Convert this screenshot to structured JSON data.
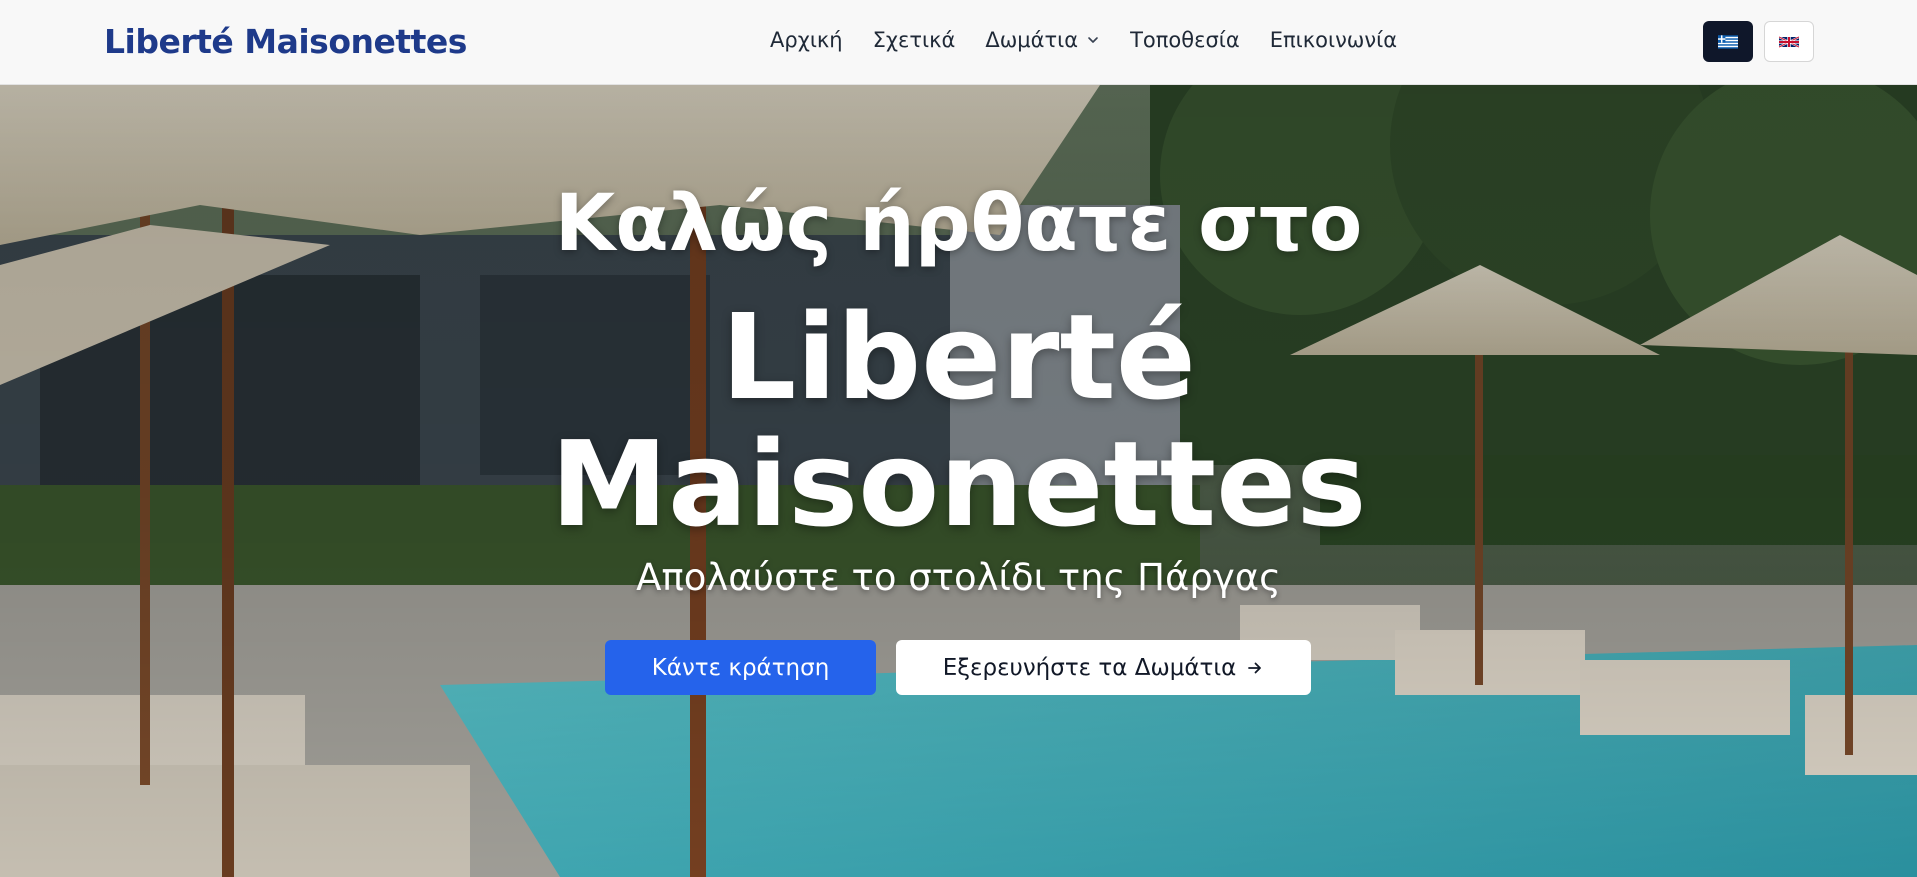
{
  "brand": {
    "name": "Liberté Maisonettes",
    "color": "#1e3a8a"
  },
  "nav": {
    "items": [
      {
        "label": "Αρχική"
      },
      {
        "label": "Σχετικά"
      },
      {
        "label": "Δωμάτια",
        "has_dropdown": true
      },
      {
        "label": "Τοποθεσία"
      },
      {
        "label": "Επικοινωνία"
      }
    ],
    "languages": [
      {
        "code": "el",
        "icon": "greece-flag-icon",
        "active": true
      },
      {
        "code": "en",
        "icon": "uk-flag-icon",
        "active": false
      }
    ]
  },
  "hero": {
    "welcome": "Καλώς ήρθατε στο",
    "title_line1": "Liberté",
    "title_line2": "Maisonettes",
    "subtitle": "Απολαύστε το στολίδι της Πάργας",
    "primary_button": "Κάντε κράτηση",
    "secondary_button": "Εξερευνήστε τα Δωμάτια",
    "secondary_button_icon": "arrow-right-icon",
    "background": "pool-with-umbrellas-photo"
  },
  "colors": {
    "primary": "#2563eb",
    "active_lang_bg": "#0f172a",
    "nav_bg": "#f8f8f8",
    "pool": "#3fb4bf"
  }
}
